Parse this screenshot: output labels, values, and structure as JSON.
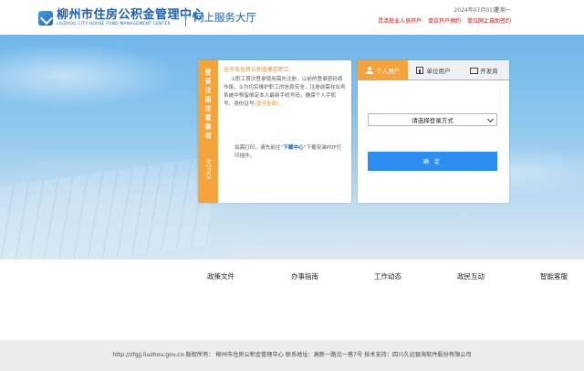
{
  "header": {
    "logo_cn": "柳州市住房公积金管理中心",
    "logo_en": "LIUZHOU CITY HOUSE FUND MANAGEMENT CENTER",
    "hall_title": "网上服务大厅",
    "date": "2024年07月01日",
    "weekday": "星期一",
    "links": [
      "灵活就业人员开户",
      "单位开户预约",
      "单位网上自助签约"
    ]
  },
  "notice": {
    "side_label": "登录注册注意事项",
    "side_label_en": "NOTICE",
    "greeting": "全市各住房公积金缴存职工:",
    "paragraph": "①职工首次登录使用需先注册，以前的登录密码将作废，②为切实维护职工的信息安全，注册前需在业务系统中预留绑定本人最新手机号码，确保个人手机号、身份证号",
    "show_all": "(显示全部)",
    "download_prefix": "如需打印，请先前往“",
    "download_link": "下载中心",
    "download_suffix": "”下载安装PDF打印插件。"
  },
  "login": {
    "tabs": [
      {
        "label": "个人用户",
        "icon": "person-icon"
      },
      {
        "label": "单位用户",
        "icon": "building-icon"
      },
      {
        "label": "开发商",
        "icon": "developer-icon"
      }
    ],
    "select_placeholder": "请选择登录方式",
    "confirm_label": "确 定"
  },
  "nav": {
    "items": [
      "政策文件",
      "办事指南",
      "工作动态",
      "政民互动",
      "智能客服"
    ]
  },
  "footer": {
    "text": "http://zfgjj.liuzhou.gov.cn-版权所有： 柳州市住房公积金管理中心  联系地址：高新一路北一巷7号  技术支持：四川久远银海软件股份有限公司"
  },
  "colors": {
    "accent_orange": "#f5a33b",
    "primary_blue": "#2d8ef2",
    "link_red": "#c40000",
    "brand_blue": "#1a5fb4"
  }
}
